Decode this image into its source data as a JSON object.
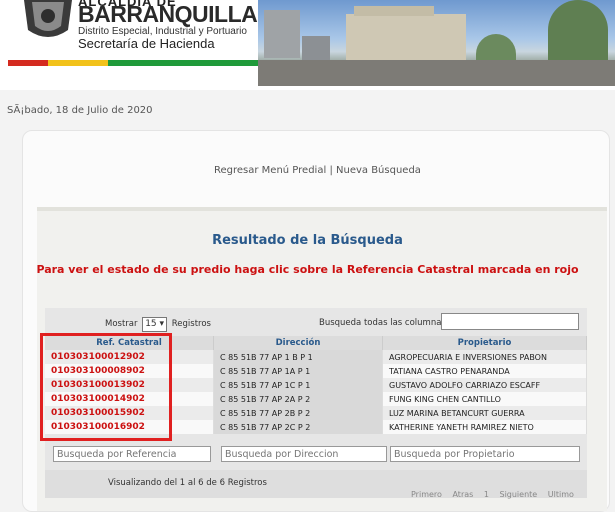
{
  "header": {
    "brand_top": "ALCALDIA DE",
    "city": "BARRANQUILLA",
    "subtitle": "Distrito Especial, Industrial y Portuario",
    "department": "Secretaría de Hacienda",
    "stripe_colors": [
      "#d42a1f",
      "#f2c21a",
      "#1f9a3a"
    ]
  },
  "date": "SÃ¡bado, 18 de Julio de 2020",
  "nav": {
    "back_label": "Regresar Menú Predial",
    "separator": "|",
    "new_search_label": "Nueva Búsqueda"
  },
  "results": {
    "title": "Resultado de la Búsqueda",
    "notice": "Para ver el estado de su predio haga clic sobre la Referencia Catastral marcada en rojo"
  },
  "toolbar": {
    "show_prefix": "Mostrar",
    "page_size": "15",
    "show_suffix": "Registros",
    "search_label": "Busqueda todas las columnas:"
  },
  "table": {
    "headers": [
      "Ref. Catastral",
      "Dirección",
      "Propietario"
    ],
    "rows": [
      {
        "ref": "010303100012902",
        "dir": "C 85 51B 77 AP 1 B P 1",
        "owner": "AGROPECUARIA E INVERSIONES PABON"
      },
      {
        "ref": "010303100008902",
        "dir": "C 85 51B 77 AP 1A P 1",
        "owner": "TATIANA CASTRO PENARANDA"
      },
      {
        "ref": "010303100013902",
        "dir": "C 85 51B 77 AP 1C P 1",
        "owner": "GUSTAVO ADOLFO CARRIAZO ESCAFF"
      },
      {
        "ref": "010303100014902",
        "dir": "C 85 51B 77 AP 2A P 2",
        "owner": "FUNG KING CHEN CANTILLO"
      },
      {
        "ref": "010303100015902",
        "dir": "C 85 51B 77 AP 2B P 2",
        "owner": "LUZ MARINA BETANCURT GUERRA"
      },
      {
        "ref": "010303100016902",
        "dir": "C 85 51B 77 AP 2C P 2",
        "owner": "KATHERINE YANETH RAMIREZ NIETO"
      }
    ]
  },
  "filters": {
    "ref_placeholder": "Busqueda por Referencia",
    "dir_placeholder": "Busqueda por Direccion",
    "owner_placeholder": "Busqueda por Propietario"
  },
  "footer": {
    "info": "Visualizando del 1 al 6 de 6 Registros",
    "first": "Primero",
    "prev": "Atras",
    "page": "1",
    "next": "Siguiente",
    "last": "Ultimo"
  }
}
